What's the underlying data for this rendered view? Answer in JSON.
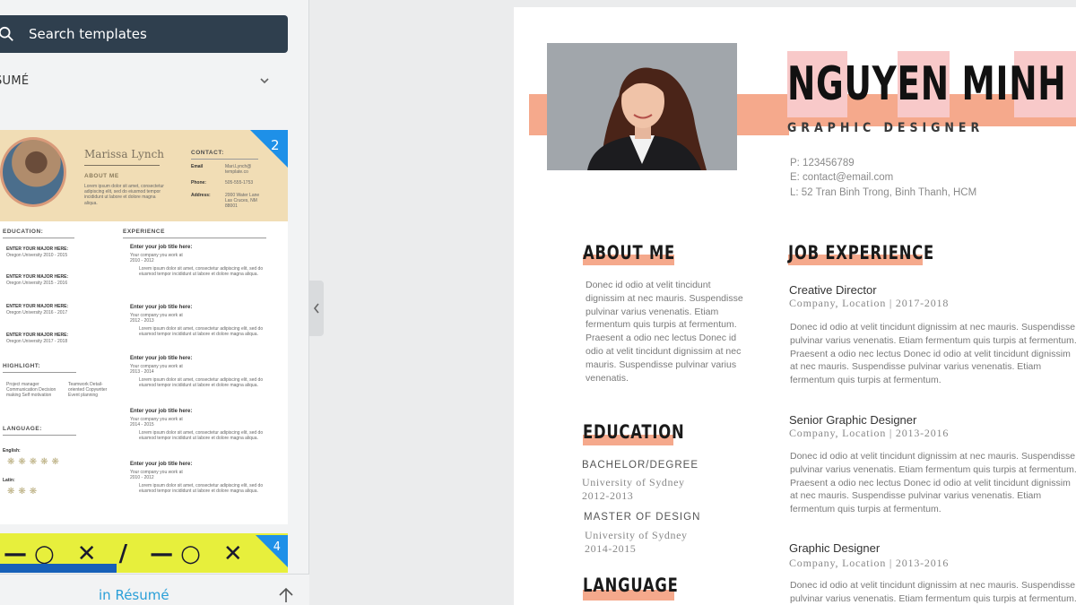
{
  "sidebar": {
    "search_placeholder": "Search templates",
    "category_label": "SUMÉ",
    "template1": {
      "name": "Marissa Lynch",
      "about_heading": "ABOUT ME",
      "contact_heading": "CONTACT:",
      "page_number": "2",
      "education_heading": "EDUCATION:",
      "experience_heading": "EXPERIENCE",
      "highlight_heading": "HIGHLIGHT:",
      "language_heading": "LANGUAGE:",
      "major_label": "ENTER YOUR MAJOR HERE:",
      "job_label": "Enter your job title here:",
      "english_label": "English:",
      "latin_label": "Latin:",
      "contact_email_label": "Email",
      "contact_phone_label": "Phone:",
      "contact_address_label": "Address:"
    },
    "template2": {
      "page_number": "4"
    },
    "more_link": "in Résumé"
  },
  "resume": {
    "name": "NGUYEN MINH THU",
    "title": "GRAPHIC DESIGNER",
    "phone": "P: 123456789",
    "email": "E: contact@email.com",
    "location": "L: 52 Tran Binh Trong, Binh Thanh, HCM",
    "about_heading": "ABOUT ME",
    "about_text": "Donec id odio at velit tincidunt dignissim at nec mauris. Suspendisse pulvinar varius venenatis. Etiam fermentum quis turpis at fermentum. Praesent a odio nec lectus Donec id odio at velit tincidunt dignissim at nec mauris. Suspendisse pulvinar varius venenatis.",
    "education_heading": "EDUCATION",
    "education": [
      {
        "degree": "BACHELOR/DEGREE",
        "school": "University of Sydney",
        "years": "2012-2013"
      },
      {
        "degree": "MASTER OF DESIGN",
        "school": "University of Sydney",
        "years": "2014-2015"
      }
    ],
    "language_heading": "LANGUAGE",
    "experience_heading": "JOB EXPERIENCE",
    "jobs": [
      {
        "title": "Creative Director",
        "meta": "Company, Location | 2017-2018",
        "desc": "Donec id odio at velit tincidunt dignissim at nec mauris. Suspendisse pulvinar varius venenatis. Etiam fermentum quis turpis at fermentum. Praesent a odio nec lectus Donec id odio at velit tincidunt dignissim at nec mauris. Suspendisse pulvinar varius venenatis. Etiam fermentum quis turpis at fermentum."
      },
      {
        "title": "Senior Graphic Designer",
        "meta": "Company, Location | 2013-2016",
        "desc": "Donec id odio at velit tincidunt dignissim at nec mauris. Suspendisse pulvinar varius venenatis. Etiam fermentum quis turpis at fermentum. Praesent a odio nec lectus Donec id odio at velit tincidunt dignissim at nec mauris. Suspendisse pulvinar varius venenatis. Etiam fermentum quis turpis at fermentum."
      },
      {
        "title": "Graphic Designer",
        "meta": "Company, Location | 2013-2016",
        "desc": "Donec id odio at velit tincidunt dignissim at nec mauris. Suspendisse pulvinar varius venenatis. Etiam fermentum quis turpis at fermentum."
      }
    ]
  },
  "colors": {
    "accent": "#f5a98c",
    "search_bg": "#2f3f4e",
    "link": "#2a9fd8",
    "badge": "#1e90e8"
  }
}
